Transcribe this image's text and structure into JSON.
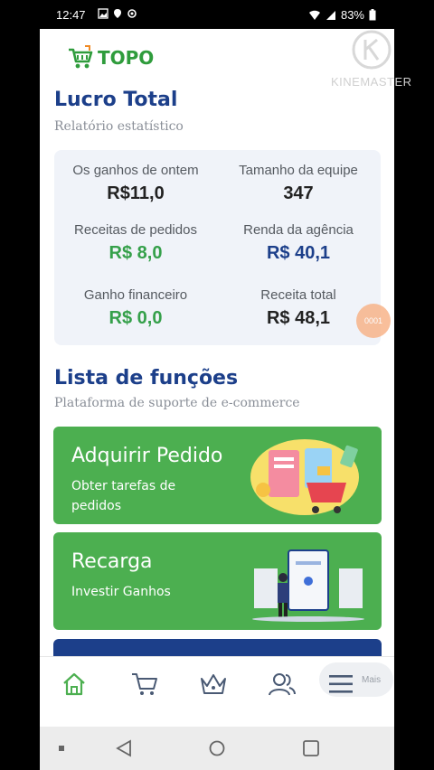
{
  "status_bar": {
    "time": "12:47",
    "battery": "83%"
  },
  "header": {
    "brand": "TOPO"
  },
  "watermark": {
    "text": "KINEMASTER"
  },
  "float_button": {
    "label": "0001"
  },
  "profit": {
    "title": "Lucro Total",
    "subtitle": "Relatório estatístico",
    "stats": [
      {
        "label": "Os ganhos de ontem",
        "value": "R$11,0",
        "color": "#222222"
      },
      {
        "label": "Tamanho da equipe",
        "value": "347",
        "color": "#222222"
      },
      {
        "label": "Receitas de pedidos",
        "value": "R$ 8,0",
        "color": "#35a04a"
      },
      {
        "label": "Renda da agência",
        "value": "R$ 40,1",
        "color": "#1c3f8a"
      },
      {
        "label": "Ganho financeiro",
        "value": "R$ 0,0",
        "color": "#35a04a"
      },
      {
        "label": "Receita total",
        "value": "R$ 48,1",
        "color": "#222222"
      }
    ]
  },
  "functions": {
    "title": "Lista de funções",
    "subtitle": "Plataforma de suporte de e-commerce",
    "cards": [
      {
        "title": "Adquirir Pedido",
        "subtitle": "Obter tarefas de pedidos"
      },
      {
        "title": "Recarga",
        "subtitle": "Investir Ganhos"
      }
    ]
  },
  "tabbar": {
    "items": [
      {
        "icon": "home-icon"
      },
      {
        "icon": "cart-icon"
      },
      {
        "icon": "crown-icon"
      },
      {
        "icon": "team-icon"
      },
      {
        "icon": "menu-icon",
        "label": "Mais"
      }
    ]
  },
  "colors": {
    "brand_green": "#4caf50",
    "title_blue": "#1c3f8a",
    "stat_bg": "#f0f3f9"
  }
}
